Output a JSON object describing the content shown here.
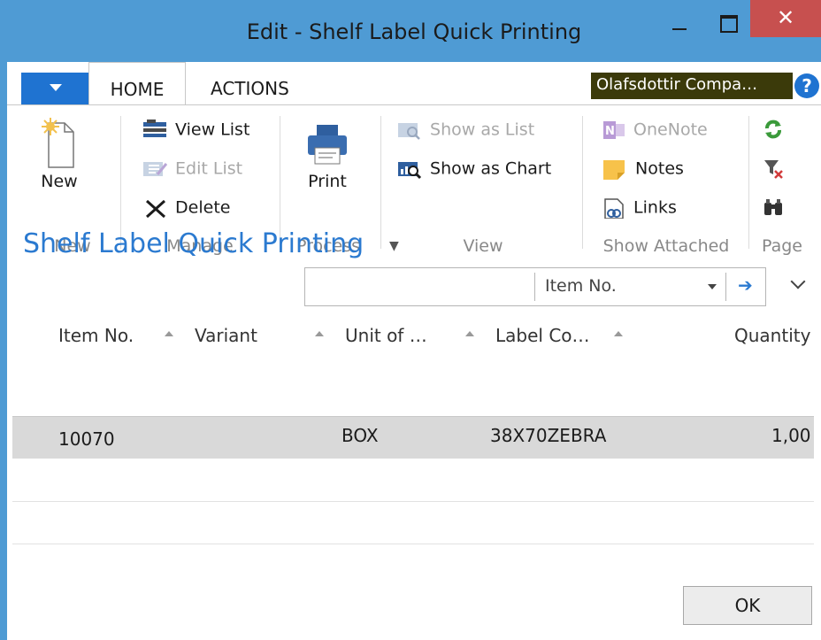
{
  "window": {
    "title": "Edit - Shelf Label Quick Printing",
    "close_glyph": "✕"
  },
  "tabs": [
    {
      "label": "HOME"
    },
    {
      "label": "ACTIONS"
    }
  ],
  "company": "Olafsdottir Compa…",
  "help_glyph": "?",
  "ribbon": {
    "groups": {
      "new": "New",
      "manage": "Manage",
      "process": "Process",
      "view": "View",
      "show_attached": "Show Attached",
      "page": "Page"
    },
    "new_label": "New",
    "view_list": "View List",
    "edit_list": "Edit List",
    "delete": "Delete",
    "print": "Print",
    "show_as_list": "Show as List",
    "show_as_chart": "Show as Chart",
    "onenote": "OneNote",
    "notes": "Notes",
    "links": "Links"
  },
  "page_title": "Shelf Label Quick Printing",
  "search": {
    "value": "",
    "field": "Item No.",
    "go_glyph": "➔"
  },
  "columns": [
    "Item No.",
    "Variant",
    "Unit of …",
    "Label Co…",
    "Quantity"
  ],
  "rows": [
    {
      "item_no": "10070",
      "variant": "",
      "unit": "BOX",
      "label_code": "38X70ZEBRA",
      "quantity": "1,00"
    }
  ],
  "ok_label": "OK",
  "colors": {
    "frame": "#4f9bd4",
    "close": "#c7504f",
    "accent": "#2b7ad0",
    "app_menu": "#1f73d1",
    "company_bg": "#3b3a0a"
  }
}
